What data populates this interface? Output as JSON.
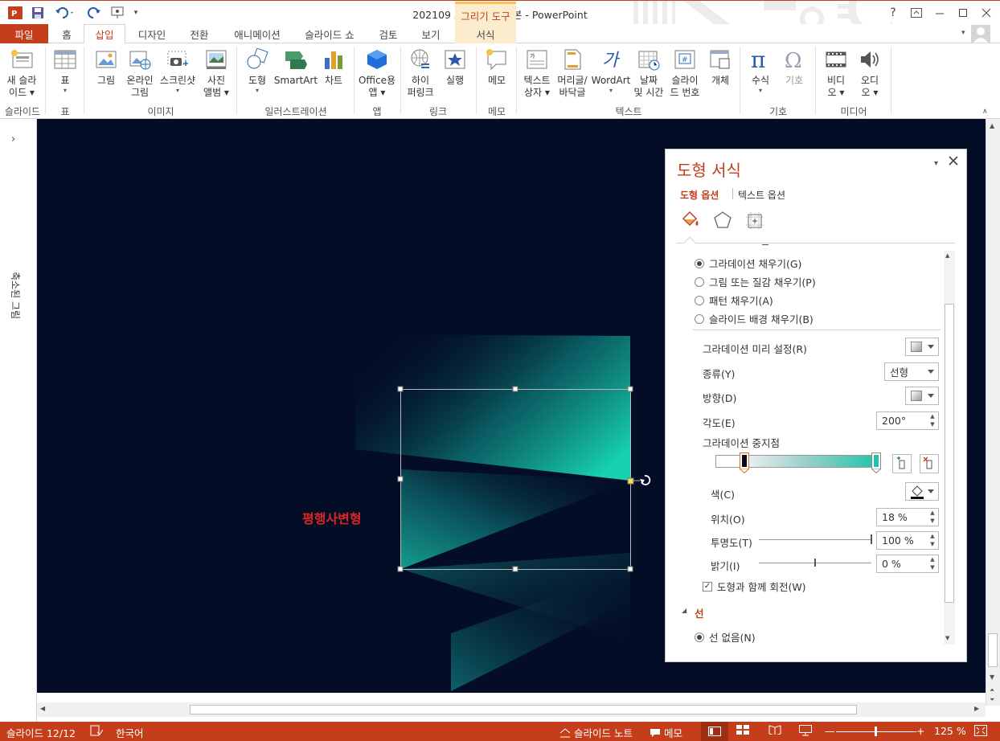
{
  "window": {
    "title": "202109 포스팅용 완성본 - PowerPoint",
    "contextual_tab_group": "그리기 도구",
    "help": "?"
  },
  "tabs": [
    {
      "id": "file",
      "label": "파일"
    },
    {
      "id": "home",
      "label": "홈"
    },
    {
      "id": "insert",
      "label": "삽입"
    },
    {
      "id": "design",
      "label": "디자인"
    },
    {
      "id": "transitions",
      "label": "전환"
    },
    {
      "id": "animations",
      "label": "애니메이션"
    },
    {
      "id": "slideshow",
      "label": "슬라이드 쇼"
    },
    {
      "id": "review",
      "label": "검토"
    },
    {
      "id": "view",
      "label": "보기"
    },
    {
      "id": "format",
      "label": "서식"
    }
  ],
  "active_tab": "삽입",
  "ribbon": {
    "buttons": {
      "new_slide": {
        "line1": "새 슬라",
        "line2": "이드 ▾"
      },
      "table": {
        "line1": "표",
        "line2": "▾"
      },
      "pictures": {
        "line1": "그림",
        "line2": ""
      },
      "online_pictures": {
        "line1": "온라인",
        "line2": "그림"
      },
      "screenshot": {
        "line1": "스크린샷",
        "line2": "▾"
      },
      "photo_album": {
        "line1": "사진",
        "line2": "앨범 ▾"
      },
      "shapes": {
        "line1": "도형",
        "line2": "▾"
      },
      "smartart": {
        "line1": "SmartArt",
        "line2": ""
      },
      "chart": {
        "line1": "차트",
        "line2": ""
      },
      "office_apps": {
        "line1": "Office용",
        "line2": "앱 ▾"
      },
      "hyperlink": {
        "line1": "하이",
        "line2": "퍼링크"
      },
      "action": {
        "line1": "실행",
        "line2": ""
      },
      "comment": {
        "line1": "메모",
        "line2": ""
      },
      "textbox": {
        "line1": "텍스트",
        "line2": "상자 ▾"
      },
      "header_footer": {
        "line1": "머리글/",
        "line2": "바닥글"
      },
      "wordart": {
        "line1": "WordArt",
        "line2": "▾"
      },
      "date_time": {
        "line1": "날짜",
        "line2": "및 시간"
      },
      "slide_number": {
        "line1": "슬라이",
        "line2": "드 번호"
      },
      "object": {
        "line1": "개체",
        "line2": ""
      },
      "equation": {
        "line1": "수식",
        "line2": "▾"
      },
      "symbol": {
        "line1": "기호",
        "line2": ""
      },
      "video": {
        "line1": "비디",
        "line2": "오 ▾"
      },
      "audio": {
        "line1": "오디",
        "line2": "오 ▾"
      }
    },
    "groups": {
      "slides": "슬라이드",
      "tables": "표",
      "images": "이미지",
      "illustrations": "일러스트레이션",
      "apps": "앱",
      "links": "링크",
      "comments": "메모",
      "text": "텍스트",
      "symbols": "기호",
      "media": "미디어"
    }
  },
  "left_pane": {
    "label": "축소된 그림"
  },
  "slide": {
    "label_text": "평행사변형",
    "label_color": "#e02424",
    "background": "#030d26",
    "accent": "#1bc4a8"
  },
  "format_pane": {
    "title": "도형 서식",
    "tab_shape": "도형 옵션",
    "tab_text": "텍스트 옵션",
    "fill_options": [
      {
        "label": "그라데이션 채우기(G)",
        "selected": true
      },
      {
        "label": "그림 또는 질감 채우기(P)",
        "selected": false
      },
      {
        "label": "패턴 채우기(A)",
        "selected": false
      },
      {
        "label": "슬라이드 배경 채우기(B)",
        "selected": false
      }
    ],
    "preset_label": "그라데이션 미리 설정(R)",
    "type_label": "종류(Y)",
    "type_value": "선형",
    "direction_label": "방향(D)",
    "angle_label": "각도(E)",
    "angle_value": "200°",
    "stops_label": "그라데이션 중지점",
    "color_label": "색(C)",
    "position_label": "위치(O)",
    "position_value": "18 %",
    "transparency_label": "투명도(T)",
    "transparency_value": "100 %",
    "transparency_level": 1.0,
    "brightness_label": "밝기(I)",
    "brightness_value": "0 %",
    "brightness_level": 0.5,
    "rotate_label": "도형과 함께 회전(W)",
    "rotate_checked": true,
    "line_section": "선",
    "line_option": "선 없음(N)"
  },
  "statusbar": {
    "slide_counter": "슬라이드 12/12",
    "language": "한국어",
    "notes": "슬라이드 노트",
    "comments": "메모",
    "zoom": "125 %"
  }
}
